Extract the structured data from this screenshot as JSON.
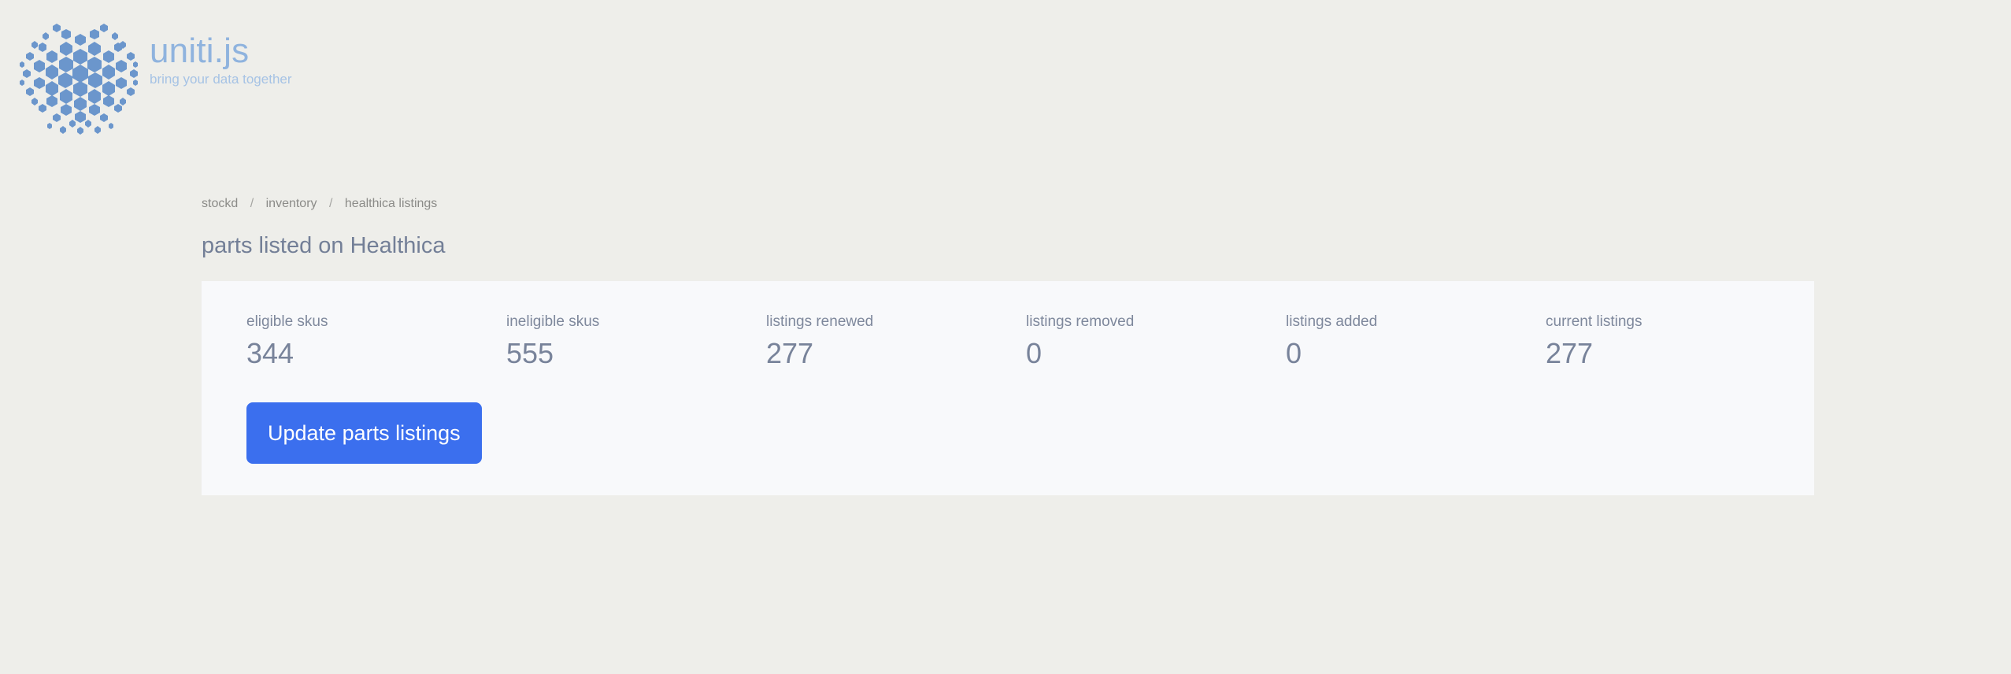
{
  "brand": {
    "logo_icon": "uniti-dots-logo-icon",
    "wordmark": "uniti.js",
    "tagline": "bring your data together",
    "logo_dot_color": "#6b96cc",
    "wordmark_color": "#8fb3de",
    "tagline_color": "#a6c3e5"
  },
  "breadcrumb": {
    "separator": "/",
    "items": [
      {
        "label": "stockd"
      },
      {
        "label": "inventory"
      },
      {
        "label": "healthica listings"
      }
    ]
  },
  "page": {
    "title": "parts listed on Healthica",
    "background_color": "#eeeeea",
    "title_color": "#737f97"
  },
  "stats_card": {
    "background_color": "#f8f9fb",
    "stats": [
      {
        "label": "eligible skus",
        "value": "344"
      },
      {
        "label": "ineligible skus",
        "value": "555"
      },
      {
        "label": "listings renewed",
        "value": "277"
      },
      {
        "label": "listings removed",
        "value": "0"
      },
      {
        "label": "listings added",
        "value": "0"
      },
      {
        "label": "current listings",
        "value": "277"
      }
    ],
    "action_button": {
      "label": "Update parts listings",
      "color": "#3b6fee",
      "text_color": "#ffffff"
    }
  }
}
